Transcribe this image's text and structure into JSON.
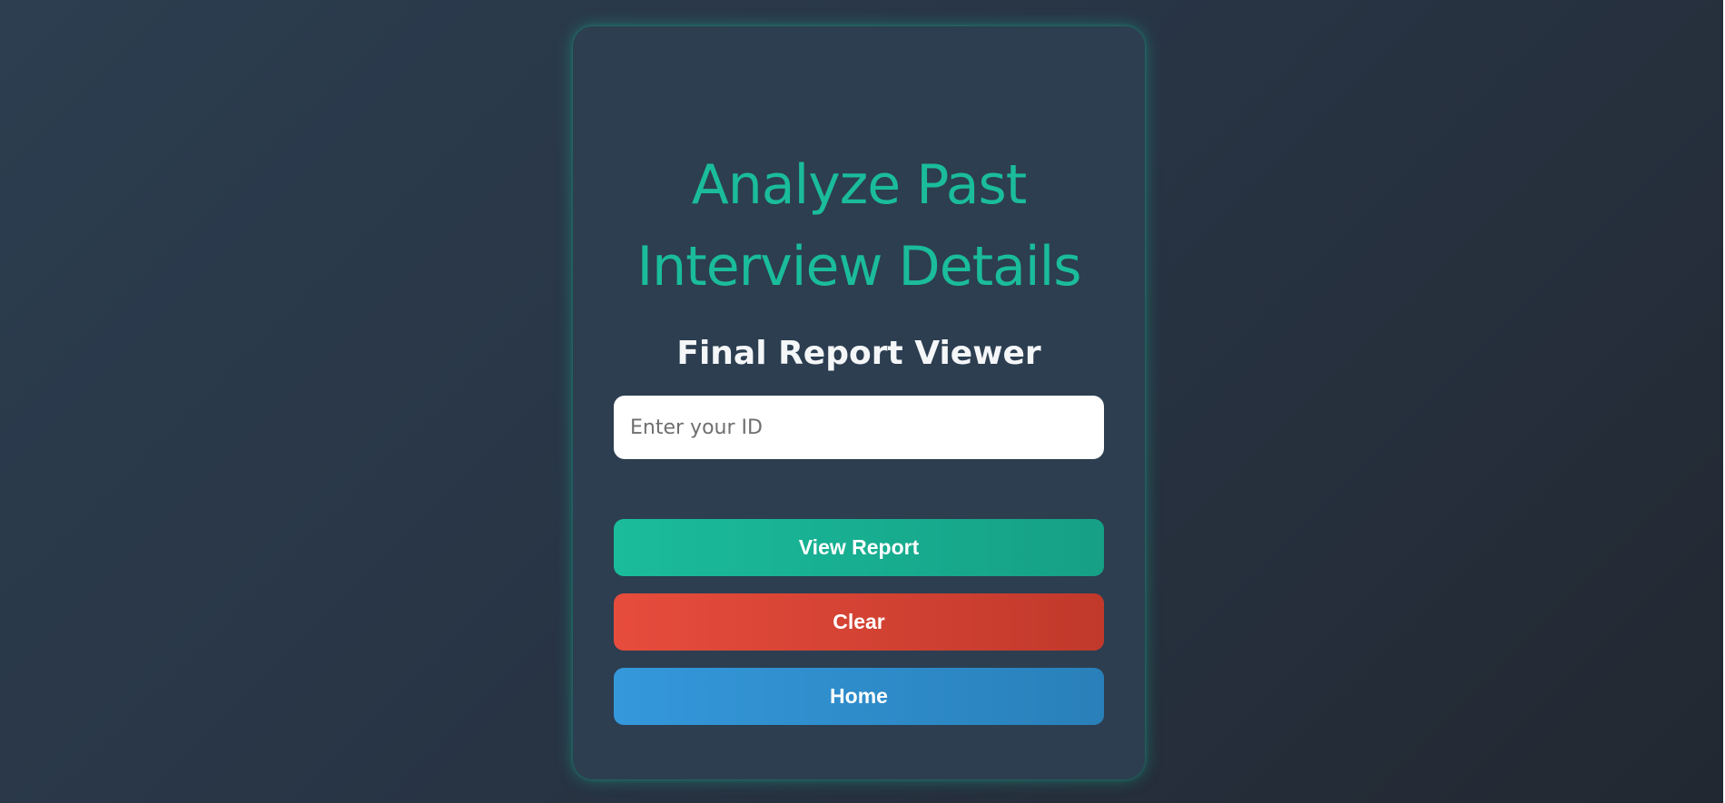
{
  "card": {
    "title_line1": "Analyze Past",
    "title_line2": "Interview Details",
    "subtitle": "Final Report Viewer",
    "id_input": {
      "placeholder": "Enter your ID",
      "value": ""
    },
    "buttons": {
      "view_report": "View Report",
      "clear": "Clear",
      "home": "Home"
    }
  },
  "colors": {
    "accent": "#1abc9c",
    "view_report": "#1abc9c",
    "clear": "#e74c3c",
    "home": "#3498db",
    "card_bg": "#2c3e50"
  }
}
